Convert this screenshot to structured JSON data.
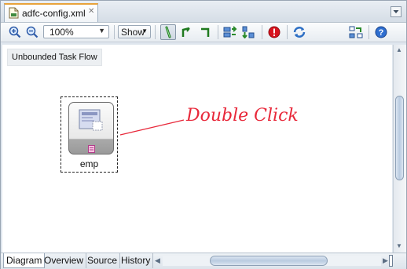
{
  "window": {
    "tab_title": "adfc-config.xml",
    "tab_close": "✕"
  },
  "toolbar": {
    "zoom_value": "100%",
    "show_label": "Show",
    "icons": [
      "zoom-in-icon",
      "zoom-out-icon",
      "select-tool-icon",
      "control-flow-icon",
      "wildcard-flow-icon",
      "layout-icon",
      "distribute-icon",
      "validate-error-icon",
      "refresh-icon",
      "overview-icon",
      "help-icon"
    ]
  },
  "canvas": {
    "flow_label": "Unbounded Task Flow",
    "activity_name": "emp",
    "callout_text": "Double Click",
    "callout_color": "#e8283a"
  },
  "bottom_tabs": [
    {
      "label": "Diagram",
      "active": true
    },
    {
      "label": "Overview",
      "active": false
    },
    {
      "label": "Source",
      "active": false
    },
    {
      "label": "History",
      "active": false
    }
  ],
  "colors": {
    "tab_accent": "#e8a23a",
    "scroll_thumb": "#b9cbe0"
  }
}
